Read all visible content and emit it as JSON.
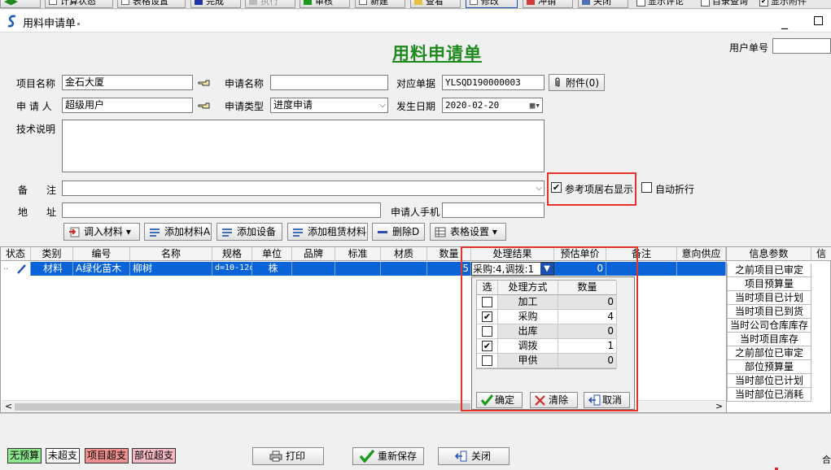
{
  "toolbar": {
    "buttons": [
      "计算状态",
      "表格设置",
      "完成",
      "执行",
      "审核",
      "新建",
      "查看",
      "修改",
      "冲销",
      "关闭"
    ],
    "checks": [
      {
        "label": "显示评论",
        "checked": false
      },
      {
        "label": "目录查询",
        "checked": false
      },
      {
        "label": "显示附件",
        "checked": true
      }
    ]
  },
  "window": {
    "title": "用料申请单",
    "close_glyph": "_"
  },
  "form": {
    "doc_title": "用料申请单",
    "user_no_label": "用户单号",
    "user_no_value": "",
    "project_label": "项目名称",
    "project_value": "金石大厦",
    "apply_name_label": "申请名称",
    "apply_name_value": "",
    "ref_doc_label": "对应单据",
    "ref_doc_value": "YLSQD190000003",
    "attach_label": "附件(0)",
    "applicant_label": "申 请 人",
    "applicant_value": "超级用户",
    "apply_type_label": "申请类型",
    "apply_type_value": "进度申请",
    "date_label": "发生日期",
    "date_value": "2020-02-20",
    "tech_label": "技术说明",
    "tech_value": "",
    "remark_label_a": "备",
    "remark_label_b": "注",
    "remark_value": "",
    "ref_right_label": "参考项居右显示",
    "ref_right_checked": true,
    "auto_wrap_label": "自动折行",
    "auto_wrap_checked": false,
    "address_label_a": "地",
    "address_label_b": "址",
    "address_value": "",
    "phone_label": "申请人手机",
    "phone_value": ""
  },
  "actions": [
    "调入材料",
    "添加材料A",
    "添加设备",
    "添加租赁材料",
    "删除D",
    "表格设置"
  ],
  "grid": {
    "columns": [
      "状态",
      "类别",
      "编号",
      "名称",
      "规格",
      "单位",
      "品牌",
      "标准",
      "材质",
      "数量",
      "处理结果",
      "预估单价",
      "备注",
      "意向供应"
    ],
    "row": {
      "status": "",
      "category": "材料",
      "code": "A绿化苗木",
      "name": "柳树",
      "spec": "d=10-12c",
      "unit": "株",
      "qty": "5",
      "result": "采购:4,调拨:1",
      "price": "0"
    }
  },
  "info": {
    "header": "信息参数",
    "header2": "信",
    "items": [
      "之前项目已审定",
      "项目预算量",
      "当时项目已计划",
      "当时项目已到货",
      "当时公司仓库库存",
      "当时项目库存",
      "之前部位已审定",
      "部位预算量",
      "当时部位已计划",
      "当时部位已消耗"
    ]
  },
  "popup": {
    "headers": [
      "选",
      "处理方式",
      "数量"
    ],
    "rows": [
      {
        "checked": false,
        "method": "加工",
        "qty": "0"
      },
      {
        "checked": true,
        "method": "采购",
        "qty": "4"
      },
      {
        "checked": false,
        "method": "出库",
        "qty": "0"
      },
      {
        "checked": true,
        "method": "调拨",
        "qty": "1"
      },
      {
        "checked": false,
        "method": "甲供",
        "qty": "0"
      }
    ],
    "ok": "确定",
    "clear": "清除",
    "cancel": "取消"
  },
  "bottom": {
    "legends": [
      {
        "label": "无预算",
        "color": "#8ee88e"
      },
      {
        "label": "未超支",
        "color": "#ffffff"
      },
      {
        "label": "项目超支",
        "color": "#f08f8f"
      },
      {
        "label": "部位超支",
        "color": "#f3b9c4"
      }
    ],
    "print": "打印",
    "resave": "重新保存",
    "close": "关闭",
    "corner": "合"
  },
  "colors": {
    "selection": "#0a64d8",
    "title_green": "#1e8a1e",
    "highlight_red": "#e8312a"
  }
}
